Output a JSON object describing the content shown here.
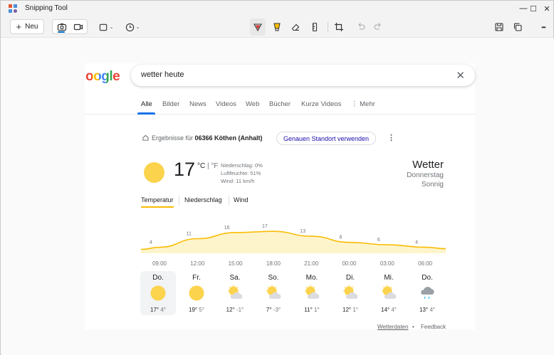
{
  "window": {
    "title": "Snipping Tool",
    "controls": {
      "minimize": "—",
      "maximize": "☐",
      "close": "✕"
    }
  },
  "toolbar": {
    "new_label": "Neu",
    "new_icon": "plus-icon",
    "more_label": "•••"
  },
  "search": {
    "logo_text": "oogle",
    "query": "wetter heute",
    "clear_icon": "close-icon"
  },
  "tabs": [
    "Alle",
    "Bilder",
    "News",
    "Videos",
    "Web",
    "Bücher",
    "Kurze Videos",
    "⋮ Mehr"
  ],
  "location": {
    "prefix": "Ergebnisse für ",
    "place": "06366 Köthen (Anhalt)",
    "button": "Genauen Standort verwenden",
    "more": "⋮"
  },
  "weather": {
    "temp": "17",
    "unit_c": "°C",
    "unit_sep": " | ",
    "unit_f": "°F",
    "precip": "Niederschlag: 0%",
    "humidity": "Luftfeuchte: 51%",
    "wind": "Wind: 11 km/h",
    "title": "Wetter",
    "day": "Donnerstag",
    "condition": "Sonnig"
  },
  "subtabs": [
    "Temperatur",
    "Niederschlag",
    "Wind"
  ],
  "chart_data": {
    "type": "area",
    "x": [
      "09:00",
      "12:00",
      "15:00",
      "18:00",
      "21:00",
      "00:00",
      "03:00",
      "06:00"
    ],
    "values": [
      4,
      11,
      16,
      17,
      13,
      8,
      6,
      4
    ],
    "color": "#fbbc04",
    "fill": "#fef4cc"
  },
  "forecast": [
    {
      "day": "Do.",
      "icon": "sun-icon",
      "hi": "17°",
      "lo": "4°"
    },
    {
      "day": "Fr.",
      "icon": "sun-icon",
      "hi": "19°",
      "lo": "5°"
    },
    {
      "day": "Sa.",
      "icon": "partly-cloudy-icon",
      "hi": "12°",
      "lo": "-1°"
    },
    {
      "day": "So.",
      "icon": "partly-cloudy-icon",
      "hi": "7°",
      "lo": "-3°"
    },
    {
      "day": "Mo.",
      "icon": "partly-cloudy-icon",
      "hi": "11°",
      "lo": "1°"
    },
    {
      "day": "Di.",
      "icon": "partly-cloudy-icon",
      "hi": "12°",
      "lo": "1°"
    },
    {
      "day": "Mi.",
      "icon": "partly-cloudy-icon",
      "hi": "14°",
      "lo": "4°"
    },
    {
      "day": "Do.",
      "icon": "rain-icon",
      "hi": "13°",
      "lo": "4°"
    }
  ],
  "footer": {
    "data_link": "Wetterdaten",
    "dot": "•",
    "feedback": "Feedback"
  }
}
